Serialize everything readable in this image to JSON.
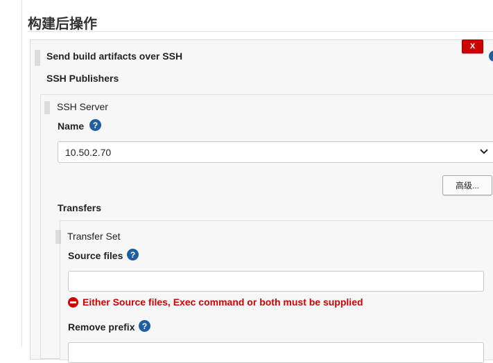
{
  "section": {
    "title": "构建后操作"
  },
  "step": {
    "title": "Send build artifacts over SSH",
    "delete_label": "X"
  },
  "publishers": {
    "label": "SSH Publishers"
  },
  "server": {
    "label": "SSH Server",
    "name_label": "Name",
    "name_value": "10.50.2.70",
    "advanced_label": "高级..."
  },
  "transfers": {
    "label": "Transfers",
    "set_label": "Transfer Set",
    "source_files_label": "Source files",
    "source_files_value": "",
    "error_text": "Either Source files, Exec command or both must be supplied",
    "remove_prefix_label": "Remove prefix",
    "remove_prefix_value": ""
  },
  "help_glyph": "?",
  "icons": [
    "drag-handle-icon",
    "help-icon",
    "error-icon",
    "chevron-down-icon"
  ],
  "colors": {
    "help": "#1f5fa0",
    "error": "#cc0000",
    "delete": "#cc0000"
  }
}
